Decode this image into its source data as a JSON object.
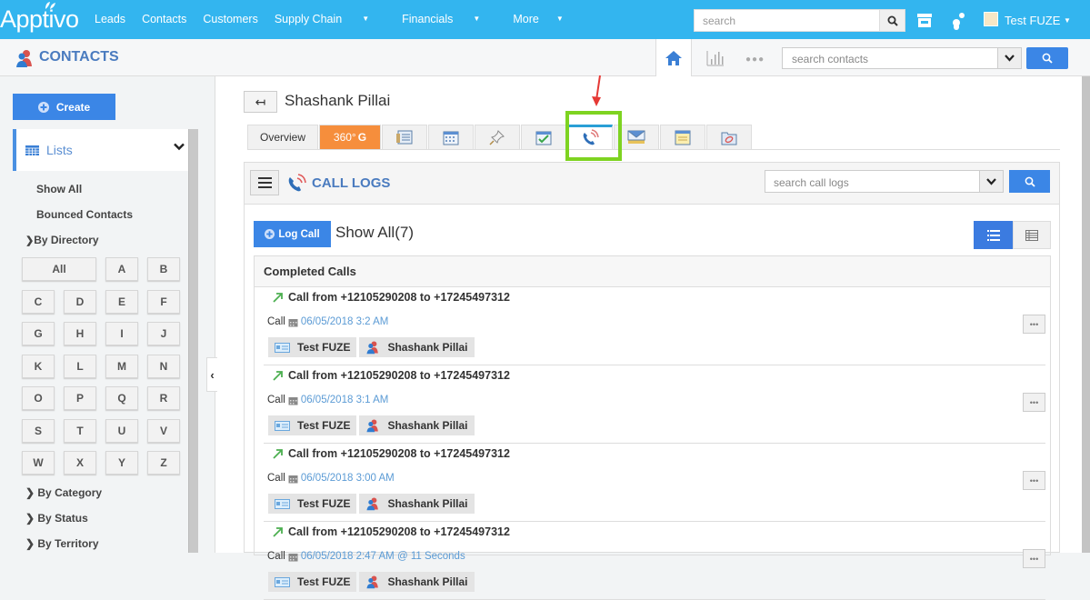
{
  "app": {
    "logo": "Apptivo",
    "nav": [
      {
        "label": "Leads",
        "dropdown": false
      },
      {
        "label": "Contacts",
        "dropdown": false
      },
      {
        "label": "Customers",
        "dropdown": false
      },
      {
        "label": "Supply Chain",
        "dropdown": true
      },
      {
        "label": "Financials",
        "dropdown": true
      },
      {
        "label": "More",
        "dropdown": true
      }
    ],
    "search_placeholder": "search",
    "user_name": "Test FUZE"
  },
  "module": {
    "title": "CONTACTS",
    "search_placeholder": "search contacts"
  },
  "sidebar": {
    "create_label": "Create",
    "lists_label": "Lists",
    "items": [
      "Show All",
      "Bounced Contacts"
    ],
    "by_directory": "By Directory",
    "letters": [
      "All",
      "A",
      "B",
      "C",
      "D",
      "E",
      "F",
      "G",
      "H",
      "I",
      "J",
      "K",
      "L",
      "M",
      "N",
      "O",
      "P",
      "Q",
      "R",
      "S",
      "T",
      "U",
      "V",
      "W",
      "X",
      "Y",
      "Z"
    ],
    "groups": [
      "By Category",
      "By Status",
      "By Territory"
    ]
  },
  "contact": {
    "name": "Shashank Pillai"
  },
  "tabs": [
    {
      "label": "Overview",
      "icon": "overview"
    },
    {
      "label": "360°",
      "icon": "360-icon"
    },
    {
      "label": "",
      "icon": "notes-card-icon"
    },
    {
      "label": "",
      "icon": "calendar-icon"
    },
    {
      "label": "",
      "icon": "pin-icon"
    },
    {
      "label": "",
      "icon": "task-check-icon"
    },
    {
      "label": "",
      "icon": "phone-call-icon",
      "active": true
    },
    {
      "label": "",
      "icon": "email-icon"
    },
    {
      "label": "",
      "icon": "sticky-note-icon"
    },
    {
      "label": "",
      "icon": "attachment-icon"
    }
  ],
  "call_logs": {
    "title": "CALL LOGS",
    "search_placeholder": "search call logs",
    "log_call_label": "Log Call",
    "show_all_label": "Show All(7)",
    "section_title": "Completed Calls",
    "calls": [
      {
        "title": "Call from +12105290208 to +17245497312",
        "type": "Call",
        "date": "06/05/2018 3:2 AM",
        "owner": "Test FUZE",
        "contact": "Shashank Pillai"
      },
      {
        "title": "Call from +12105290208 to +17245497312",
        "type": "Call",
        "date": "06/05/2018 3:1 AM",
        "owner": "Test FUZE",
        "contact": "Shashank Pillai"
      },
      {
        "title": "Call from +12105290208 to +17245497312",
        "type": "Call",
        "date": "06/05/2018 3:00 AM",
        "owner": "Test FUZE",
        "contact": "Shashank Pillai"
      },
      {
        "title": "Call from +12105290208 to +17245497312",
        "type": "Call",
        "date": "06/05/2018 2:47 AM @ 11 Seconds",
        "owner": "Test FUZE",
        "contact": "Shashank Pillai"
      }
    ],
    "more_label": "•••"
  },
  "colors": {
    "topbar": "#33b5ef",
    "primary_button": "#3b86e6",
    "tab_360": "#f68e3c",
    "highlight": "#7ed321",
    "title_blue": "#4a7bbf"
  }
}
